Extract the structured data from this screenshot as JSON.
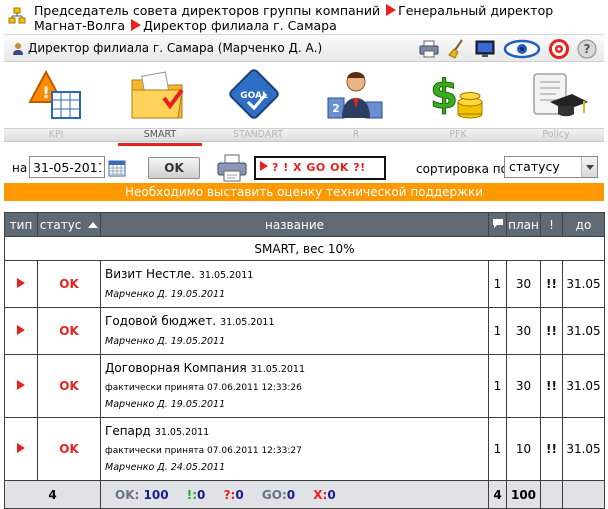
{
  "breadcrumb": {
    "part1": "Председатель совета директоров группы компаний",
    "part2": "Генеральный директор Магнат-Волга",
    "part3": "Директор филиала г. Самара"
  },
  "user": {
    "label": "Директор филиала г. Самара  (Марченко Д. А.)"
  },
  "modules": [
    {
      "label": "KPI",
      "active": false
    },
    {
      "label": "SMART",
      "active": true
    },
    {
      "label": "STANDART",
      "active": false
    },
    {
      "label": "R",
      "active": false
    },
    {
      "label": "PFK",
      "active": false
    },
    {
      "label": "Policy",
      "active": false
    }
  ],
  "controls": {
    "on_label": "на",
    "date": "31-05-2011",
    "ok_label": "OK",
    "legend": "? ! X GO OK ?!",
    "sort_label": "сортировка по",
    "sort_value": "статусу"
  },
  "warning": "Необходимо выставить оценку технической поддержки",
  "table": {
    "headers": {
      "type": "тип",
      "status": "статус",
      "name": "название",
      "plan": "план",
      "excl": "!",
      "due": "до"
    },
    "section": "SMART, вес 10%",
    "rows": [
      {
        "status": "OK",
        "title": "Визит Нестле.",
        "date": "31.05.2011",
        "extra": "",
        "author": "Марченко Д. 19.05.2011",
        "count": "1",
        "plan": "30",
        "excl": "!!",
        "due": "31.05"
      },
      {
        "status": "OK",
        "title": "Годовой бюджет.",
        "date": "31.05.2011",
        "extra": "",
        "author": "Марченко Д. 19.05.2011",
        "count": "1",
        "plan": "30",
        "excl": "!!",
        "due": "31.05"
      },
      {
        "status": "OK",
        "title": "Договорная Компания",
        "date": "31.05.2011",
        "extra": "фактически принята 07.06.2011 12:33:26",
        "author": "Марченко Д. 19.05.2011",
        "count": "1",
        "plan": "30",
        "excl": "!!",
        "due": "31.05"
      },
      {
        "status": "OK",
        "title": "Гепард",
        "date": "31.05.2011",
        "extra": "фактически принята 07.06.2011 12:33:27",
        "author": "Марченко Д. 24.05.2011",
        "count": "1",
        "plan": "10",
        "excl": "!!",
        "due": "31.05"
      }
    ],
    "total": {
      "count": "4",
      "ok_label": "OK:",
      "ok_value": "100",
      "excl_label": "!:",
      "excl_value": "0",
      "q_label": "?:",
      "q_value": "0",
      "go_label": "GO:",
      "go_value": "0",
      "x_label": "X:",
      "x_value": "0",
      "sum_count": "4",
      "sum_plan": "100"
    }
  },
  "colors": {
    "accent": "#e8231f",
    "warning": "#ff9900",
    "header": "#606a73",
    "ok_green": "#2aa12a"
  }
}
